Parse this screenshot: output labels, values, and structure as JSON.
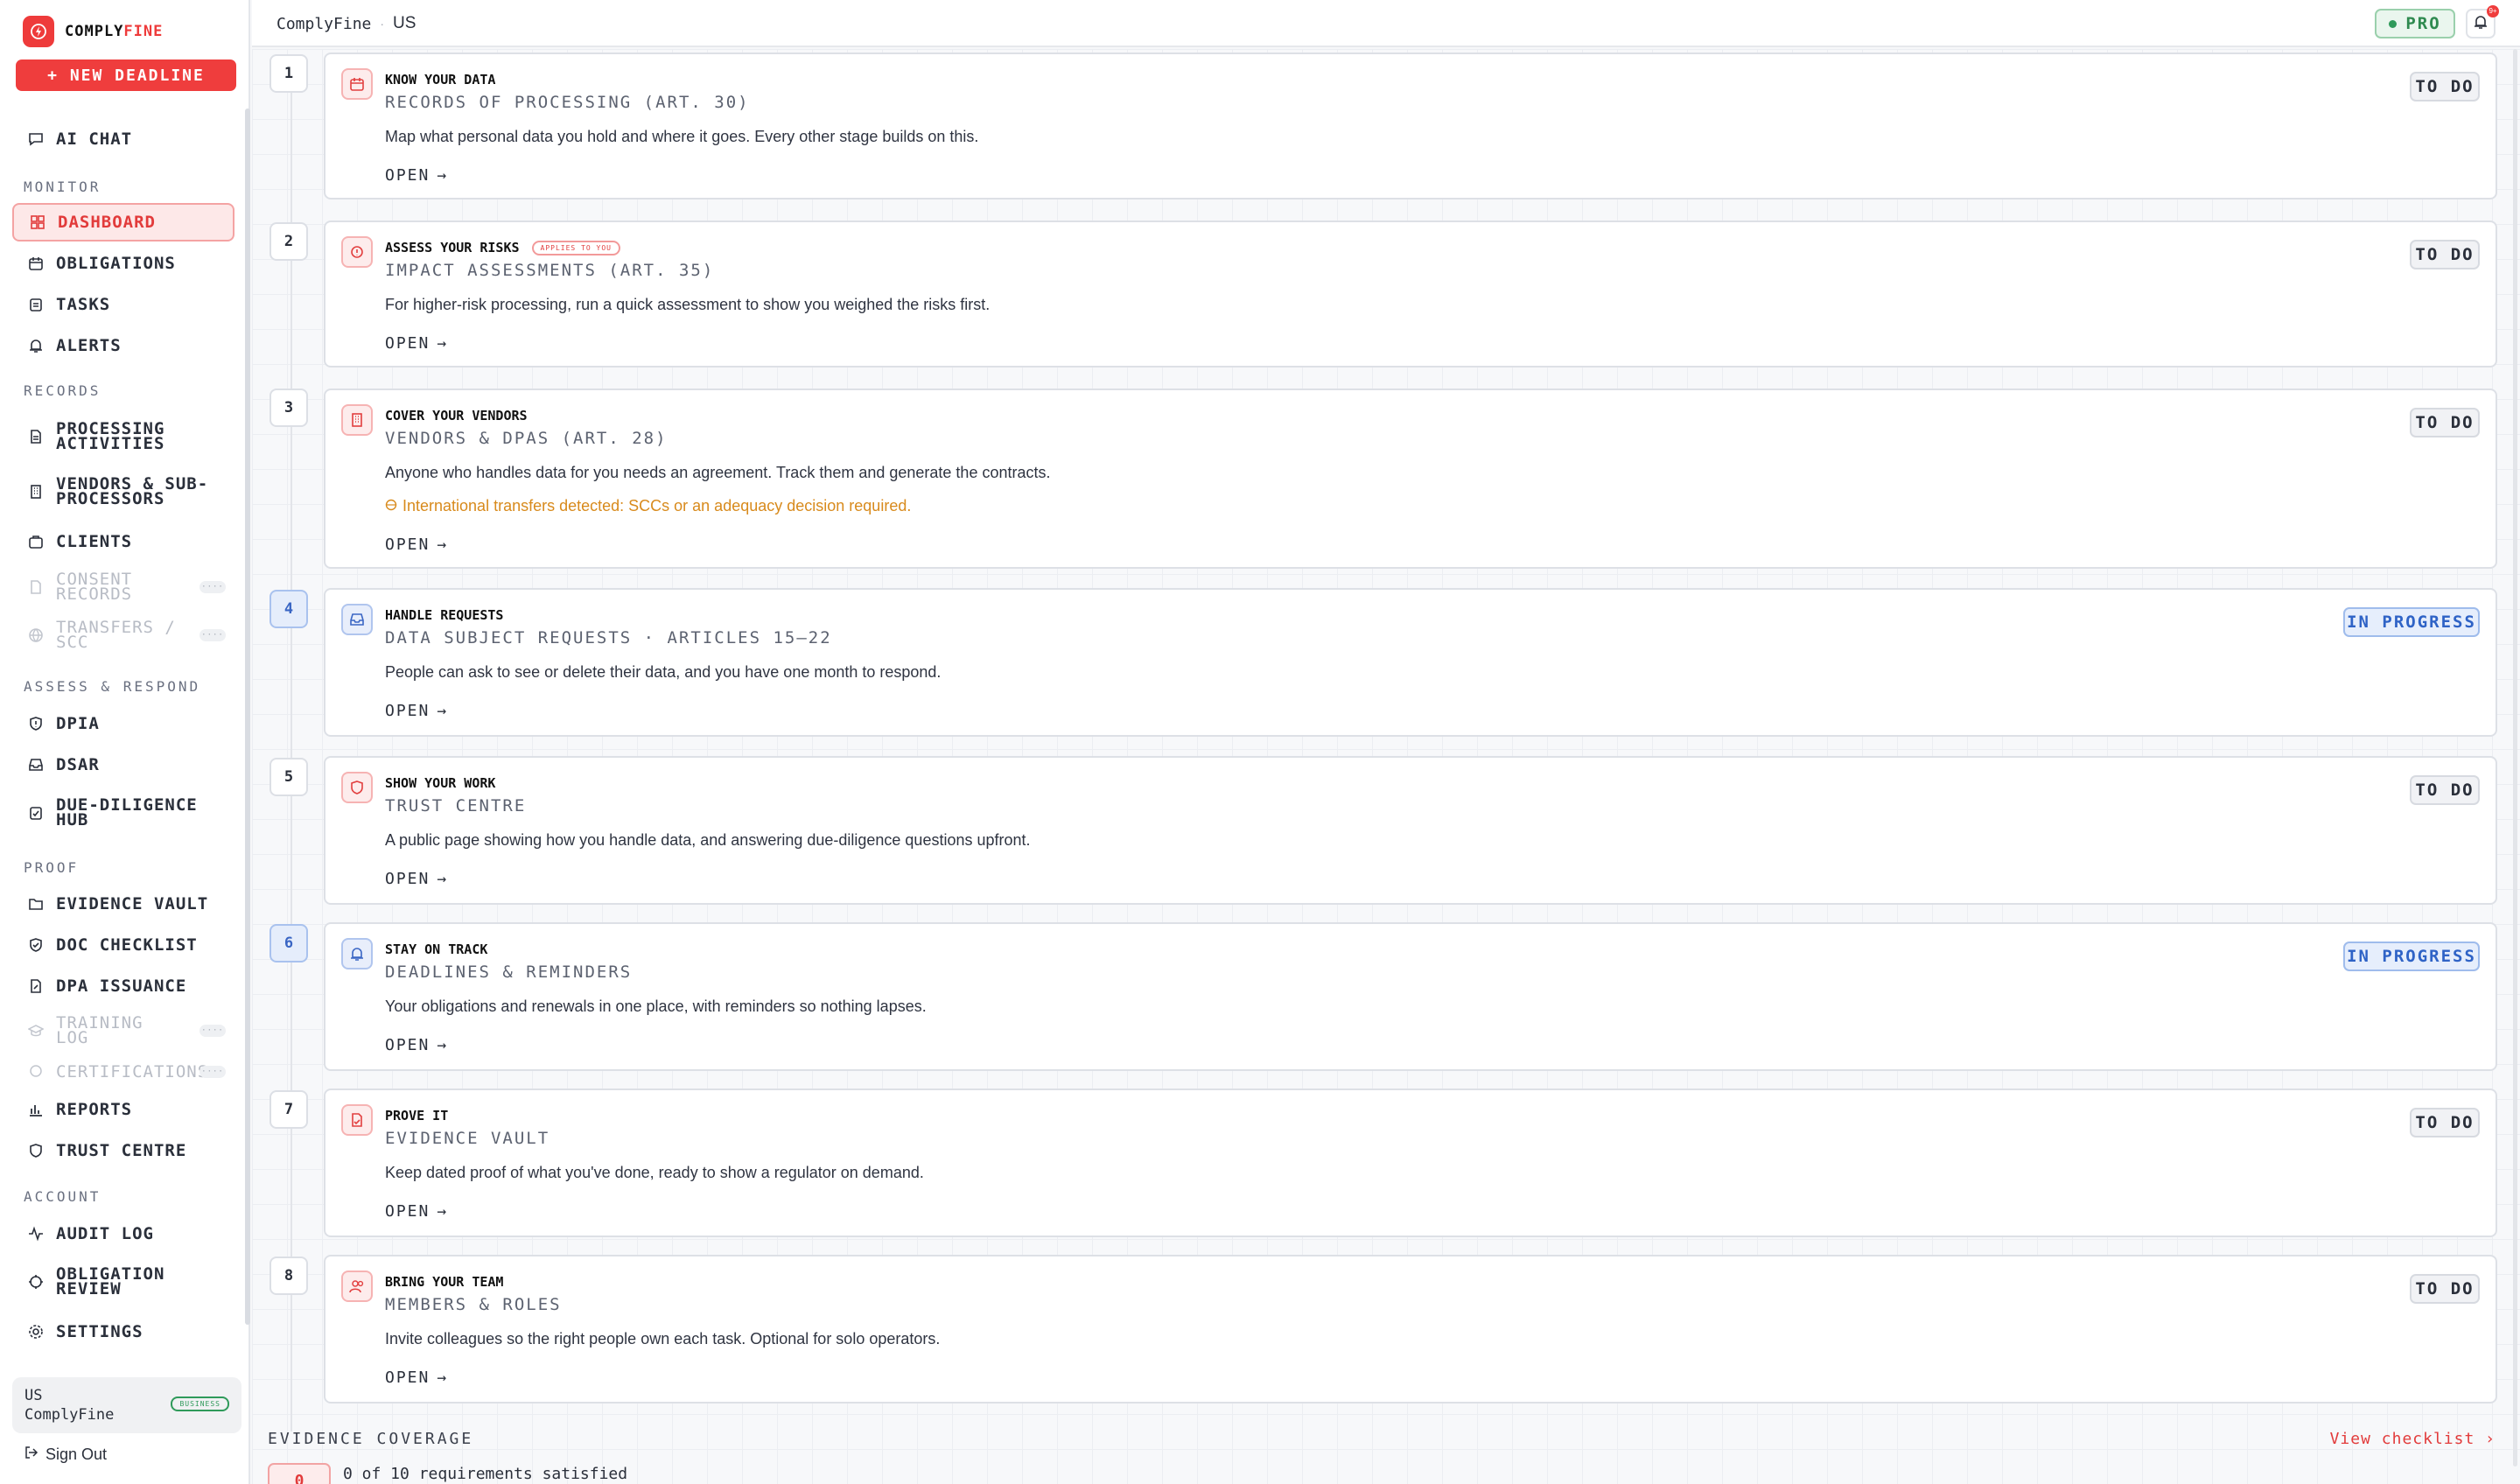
{
  "brand": {
    "name_prefix": "COMPLY",
    "name_suffix": "FINE",
    "accent": "#ee3b3b"
  },
  "sidebar": {
    "new_deadline": "+ NEW DEADLINE",
    "ai_chat": "AI CHAT",
    "sections": {
      "monitor": "MONITOR",
      "records": "RECORDS",
      "assess": "ASSESS & RESPOND",
      "proof": "PROOF",
      "account": "ACCOUNT"
    },
    "items": {
      "dashboard": "DASHBOARD",
      "obligations": "OBLIGATIONS",
      "tasks": "TASKS",
      "alerts": "ALERTS",
      "processing_activities": "PROCESSING ACTIVITIES",
      "vendors": "VENDORS & SUB-PROCESSORS",
      "clients": "CLIENTS",
      "consent_records": "CONSENT RECORDS",
      "transfers": "TRANSFERS / SCC",
      "dpia": "DPIA",
      "dsar": "DSAR",
      "due_diligence": "DUE-DILIGENCE HUB",
      "evidence_vault": "EVIDENCE VAULT",
      "doc_checklist": "DOC CHECKLIST",
      "dpa_issuance": "DPA ISSUANCE",
      "training_log": "TRAINING LOG",
      "certifications": "CERTIFICATIONS",
      "reports": "REPORTS",
      "trust_centre": "TRUST CENTRE",
      "audit_log": "AUDIT LOG",
      "obligation_review": "OBLIGATION REVIEW",
      "settings": "SETTINGS"
    },
    "user": {
      "region": "US",
      "org": "ComplyFine",
      "plan": "BUSINESS"
    },
    "sign_out": "Sign Out"
  },
  "topbar": {
    "breadcrumb_brand": "ComplyFine",
    "breadcrumb_sep": "·",
    "breadcrumb_region": "US",
    "plan_badge": "PRO",
    "notif_count": "9+"
  },
  "steps": [
    {
      "num": "1",
      "title": "KNOW YOUR DATA",
      "subtitle": "RECORDS OF PROCESSING (ART. 30)",
      "desc": "Map what personal data you hold and where it goes. Every other stage builds on this.",
      "status": "TO DO",
      "open": "OPEN"
    },
    {
      "num": "2",
      "title": "ASSESS YOUR RISKS",
      "tag": "APPLIES TO YOU",
      "subtitle": "IMPACT ASSESSMENTS (ART. 35)",
      "desc": "For higher-risk processing, run a quick assessment to show you weighed the risks first.",
      "status": "TO DO",
      "open": "OPEN"
    },
    {
      "num": "3",
      "title": "COVER YOUR VENDORS",
      "subtitle": "VENDORS & DPAS (ART. 28)",
      "desc": "Anyone who handles data for you needs an agreement. Track them and generate the contracts.",
      "warning": "International transfers detected: SCCs or an adequacy decision required.",
      "status": "TO DO",
      "open": "OPEN"
    },
    {
      "num": "4",
      "title": "HANDLE REQUESTS",
      "subtitle": "DATA SUBJECT REQUESTS · ARTICLES 15–22",
      "desc": "People can ask to see or delete their data, and you have one month to respond.",
      "status": "IN PROGRESS",
      "open": "OPEN"
    },
    {
      "num": "5",
      "title": "SHOW YOUR WORK",
      "subtitle": "TRUST CENTRE",
      "desc": "A public page showing how you handle data, and answering due-diligence questions upfront.",
      "status": "TO DO",
      "open": "OPEN"
    },
    {
      "num": "6",
      "title": "STAY ON TRACK",
      "subtitle": "DEADLINES & REMINDERS",
      "desc": "Your obligations and renewals in one place, with reminders so nothing lapses.",
      "status": "IN PROGRESS",
      "open": "OPEN"
    },
    {
      "num": "7",
      "title": "PROVE IT",
      "subtitle": "EVIDENCE VAULT",
      "desc": "Keep dated proof of what you've done, ready to show a regulator on demand.",
      "status": "TO DO",
      "open": "OPEN"
    },
    {
      "num": "8",
      "title": "BRING YOUR TEAM",
      "subtitle": "MEMBERS & ROLES",
      "desc": "Invite colleagues so the right people own each task. Optional for solo operators.",
      "status": "TO DO",
      "open": "OPEN"
    }
  ],
  "coverage": {
    "label": "EVIDENCE COVERAGE",
    "view_checklist": "View checklist",
    "count": "0",
    "summary": "0 of 10 requirements satisfied"
  }
}
